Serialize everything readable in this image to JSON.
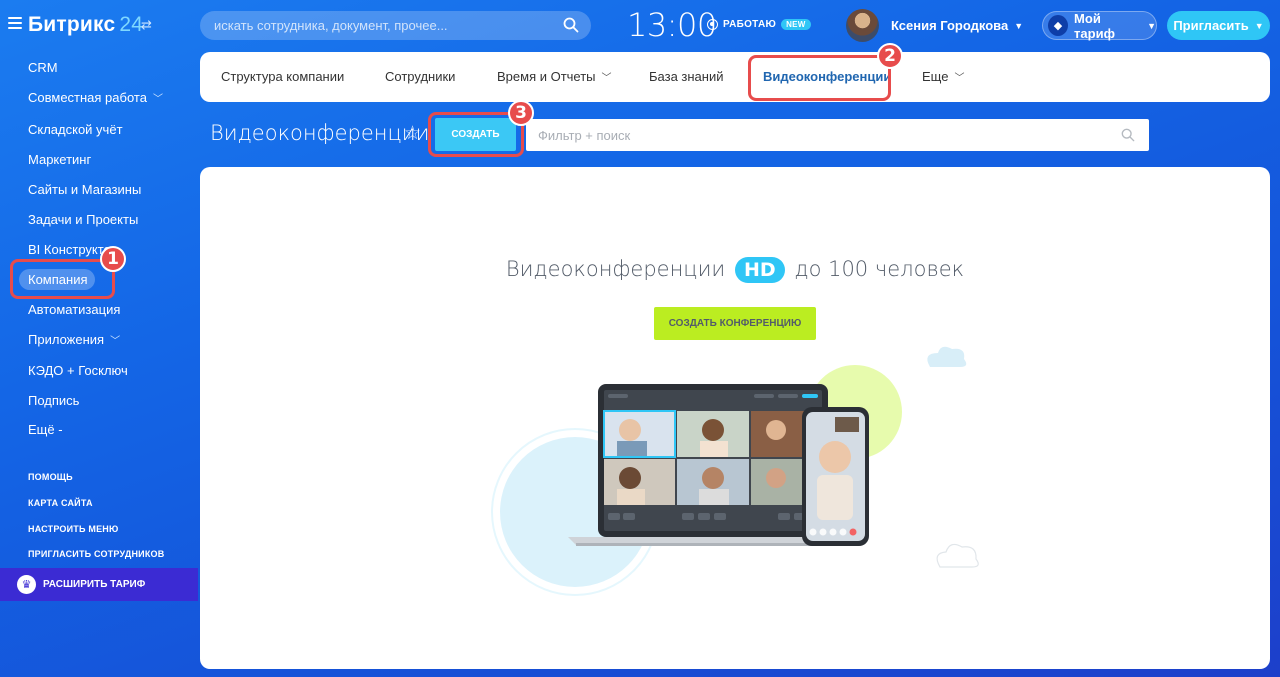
{
  "topbar": {
    "logo_text": "Битрикс",
    "logo_num": "24",
    "search_placeholder": "искать сотрудника, документ, прочее...",
    "clock": "13:00",
    "work_status": "РАБОТАЮ",
    "new_badge": "NEW",
    "user_name": "Ксения Городкова",
    "tariff_label": "Мой тариф",
    "invite_label": "Пригласить"
  },
  "sidebar": {
    "items": [
      {
        "label": "CRM"
      },
      {
        "label": "Совместная работа"
      },
      {
        "label": "Складской учёт"
      },
      {
        "label": "Маркетинг"
      },
      {
        "label": "Сайты и Магазины"
      },
      {
        "label": "Задачи и Проекты"
      },
      {
        "label": "BI Конструктор"
      },
      {
        "label": "Компания"
      },
      {
        "label": "Автоматизация"
      },
      {
        "label": "Приложения"
      },
      {
        "label": "КЭДО + Госключ"
      },
      {
        "label": "Подпись"
      },
      {
        "label": "Ещё -"
      }
    ],
    "links": [
      {
        "label": "ПОМОЩЬ"
      },
      {
        "label": "КАРТА САЙТА"
      },
      {
        "label": "НАСТРОИТЬ МЕНЮ"
      },
      {
        "label": "ПРИГЛАСИТЬ СОТРУДНИКОВ"
      }
    ],
    "upgrade_label": "РАСШИРИТЬ ТАРИФ"
  },
  "tabs": [
    {
      "label": "Структура компании"
    },
    {
      "label": "Сотрудники"
    },
    {
      "label": "Время и Отчеты"
    },
    {
      "label": "База знаний"
    },
    {
      "label": "Видеоконференции"
    },
    {
      "label": "Еще"
    }
  ],
  "toolbar": {
    "title": "Видеоконференции",
    "create_label": "СОЗДАТЬ",
    "filter_placeholder": "Фильтр + поиск"
  },
  "main": {
    "headline_start": "Видеоконференции",
    "hd": "HD",
    "headline_end": "до 100 человек",
    "conf_button": "СОЗДАТЬ КОНФЕРЕНЦИЮ"
  },
  "annotations": [
    "1",
    "2",
    "3"
  ],
  "colors": {
    "accent": "#2fc6f6",
    "lime": "#bbed21",
    "highlight": "#e74c4c",
    "active_tab": "#2066b0"
  }
}
